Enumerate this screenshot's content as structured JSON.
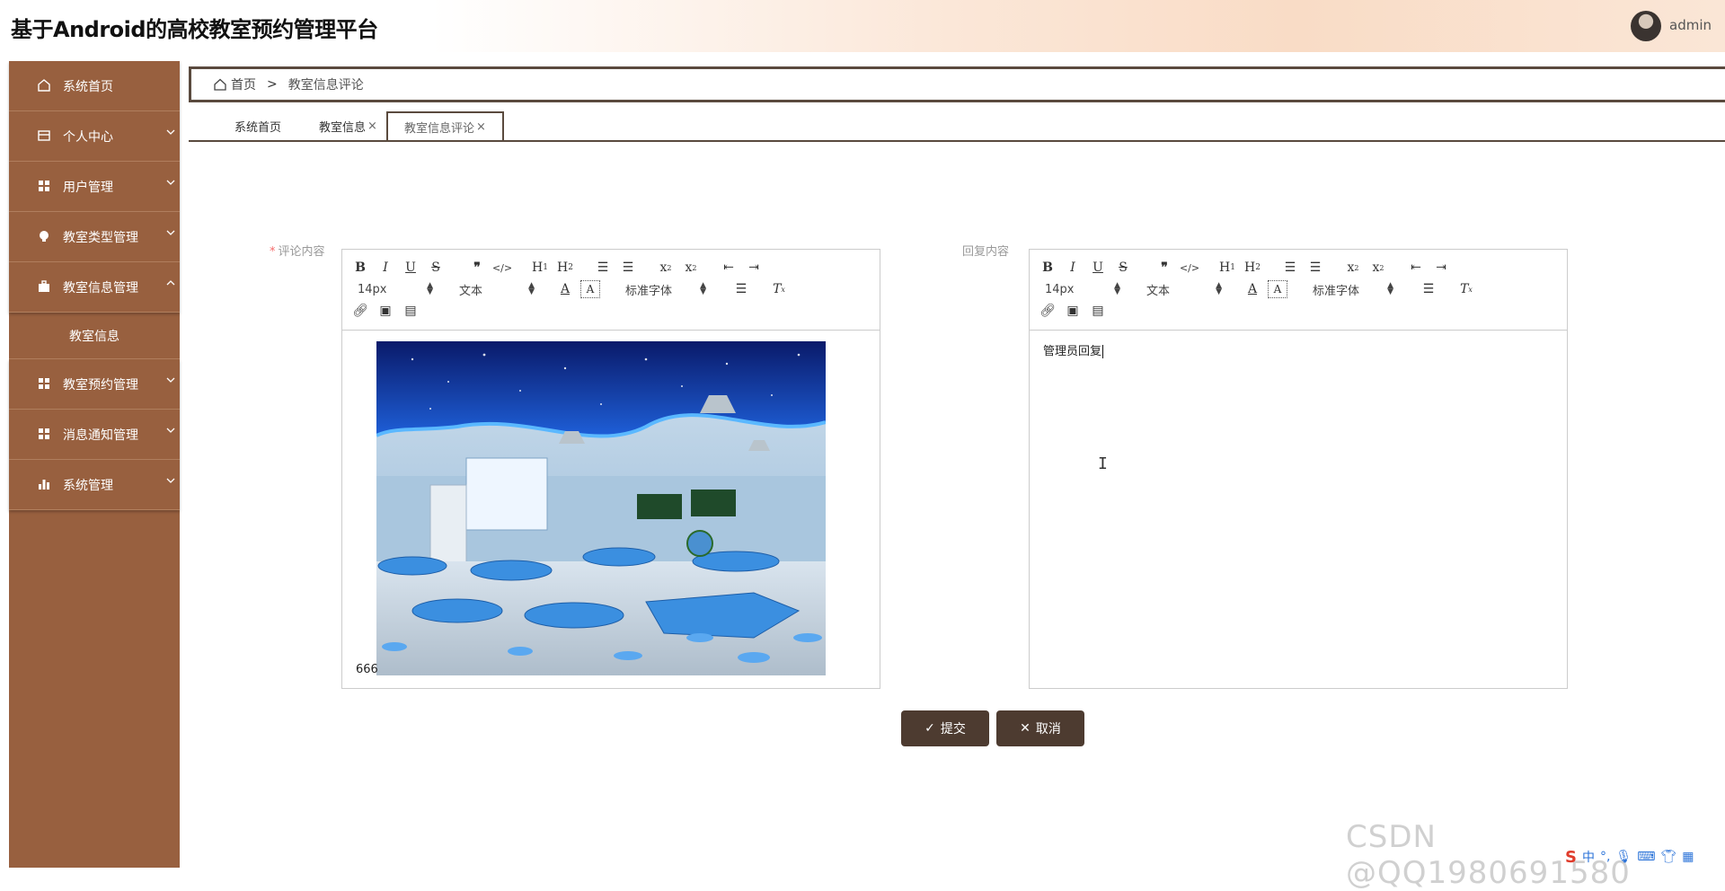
{
  "app": {
    "title": "基于Android的高校教室预约管理平台",
    "user": "admin"
  },
  "sidebar": {
    "items": [
      {
        "label": "系统首页",
        "icon": "home-icon"
      },
      {
        "label": "个人中心",
        "icon": "card-icon"
      },
      {
        "label": "用户管理",
        "icon": "grid-icon"
      },
      {
        "label": "教室类型管理",
        "icon": "bulb-icon"
      },
      {
        "label": "教室信息管理",
        "icon": "briefcase-icon"
      },
      {
        "label": "教室预约管理",
        "icon": "grid-icon"
      },
      {
        "label": "消息通知管理",
        "icon": "grid-icon"
      },
      {
        "label": "系统管理",
        "icon": "bar-chart-icon"
      }
    ],
    "submenu": {
      "label": "教室信息"
    }
  },
  "breadcrumb": {
    "home": "首页",
    "sep": ">",
    "current": "教室信息评论"
  },
  "tabs": [
    {
      "label": "系统首页"
    },
    {
      "label": "教室信息",
      "close": "×"
    },
    {
      "label": "教室信息评论",
      "close": "×"
    }
  ],
  "form": {
    "comment_label": "评论内容",
    "required_mark": "*",
    "reply_label": "回复内容",
    "comment_text": "666",
    "reply_text": "管理员回复",
    "toolbar": {
      "size": "14px",
      "header": "文本",
      "font": "标准字体"
    }
  },
  "buttons": {
    "submit": "提交",
    "cancel": "取消"
  },
  "watermark": "CSDN @QQ1980691580",
  "tray": {
    "ime": "中"
  }
}
